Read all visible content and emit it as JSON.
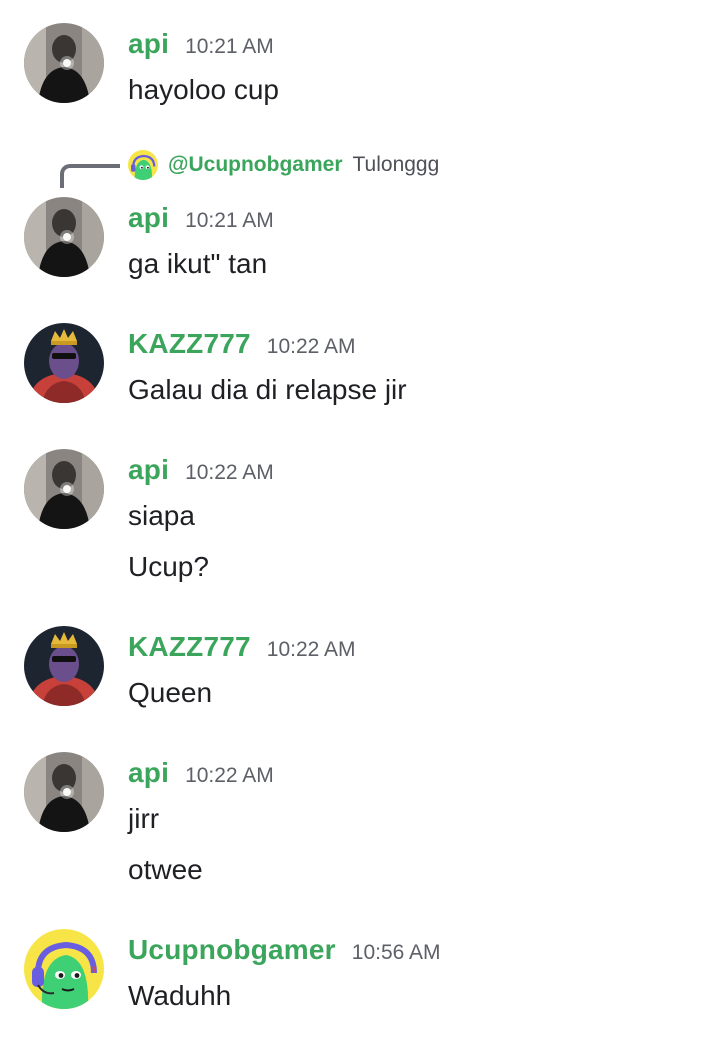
{
  "messages": [
    {
      "author": "api",
      "time": "10:21 AM",
      "lines": [
        "hayoloo cup"
      ],
      "avatar_icon": "user-photo-icon"
    },
    {
      "author": "api",
      "time": "10:21 AM",
      "reply": {
        "user": "@Ucupnobgamer",
        "text": "Tulonggg"
      },
      "lines": [
        "ga ikut\" tan"
      ],
      "avatar_icon": "user-photo-icon"
    },
    {
      "author": "KAZZ777",
      "time": "10:22 AM",
      "lines": [
        "Galau dia di relapse jir"
      ],
      "avatar_icon": "crowned-character-icon"
    },
    {
      "author": "api",
      "time": "10:22 AM",
      "lines": [
        "siapa",
        "Ucup?"
      ],
      "avatar_icon": "user-photo-icon"
    },
    {
      "author": "KAZZ777",
      "time": "10:22 AM",
      "lines": [
        "Queen"
      ],
      "avatar_icon": "crowned-character-icon"
    },
    {
      "author": "api",
      "time": "10:22 AM",
      "lines": [
        "jirr",
        "otwee"
      ],
      "avatar_icon": "user-photo-icon"
    },
    {
      "author": "Ucupnobgamer",
      "time": "10:56 AM",
      "lines": [
        "Waduhh"
      ],
      "avatar_icon": "green-gamer-character-icon"
    }
  ],
  "colors": {
    "username": "#3ba55c",
    "timestamp": "#5e6068",
    "text": "#1f2024",
    "reply_line": "#6b6e76"
  }
}
